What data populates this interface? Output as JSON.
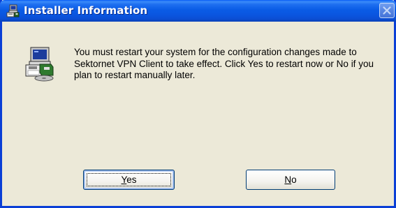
{
  "window": {
    "title": "Installer Information",
    "title_icon": "installer-icon",
    "close_icon": "close-icon",
    "colors": {
      "titlebar": "#0a5ce6",
      "frame": "#0a3fd6",
      "body": "#ece9d8",
      "button_border": "#003c74"
    }
  },
  "dialog": {
    "icon": "computer-installer-icon",
    "message": "You must restart your system for the configuration changes made to Sektornet VPN Client to take effect. Click Yes to restart now or No if you plan to restart manually later."
  },
  "buttons": {
    "yes": {
      "accel": "Y",
      "rest": "es",
      "is_default": true
    },
    "no": {
      "accel": "N",
      "rest": "o",
      "is_default": false
    }
  }
}
